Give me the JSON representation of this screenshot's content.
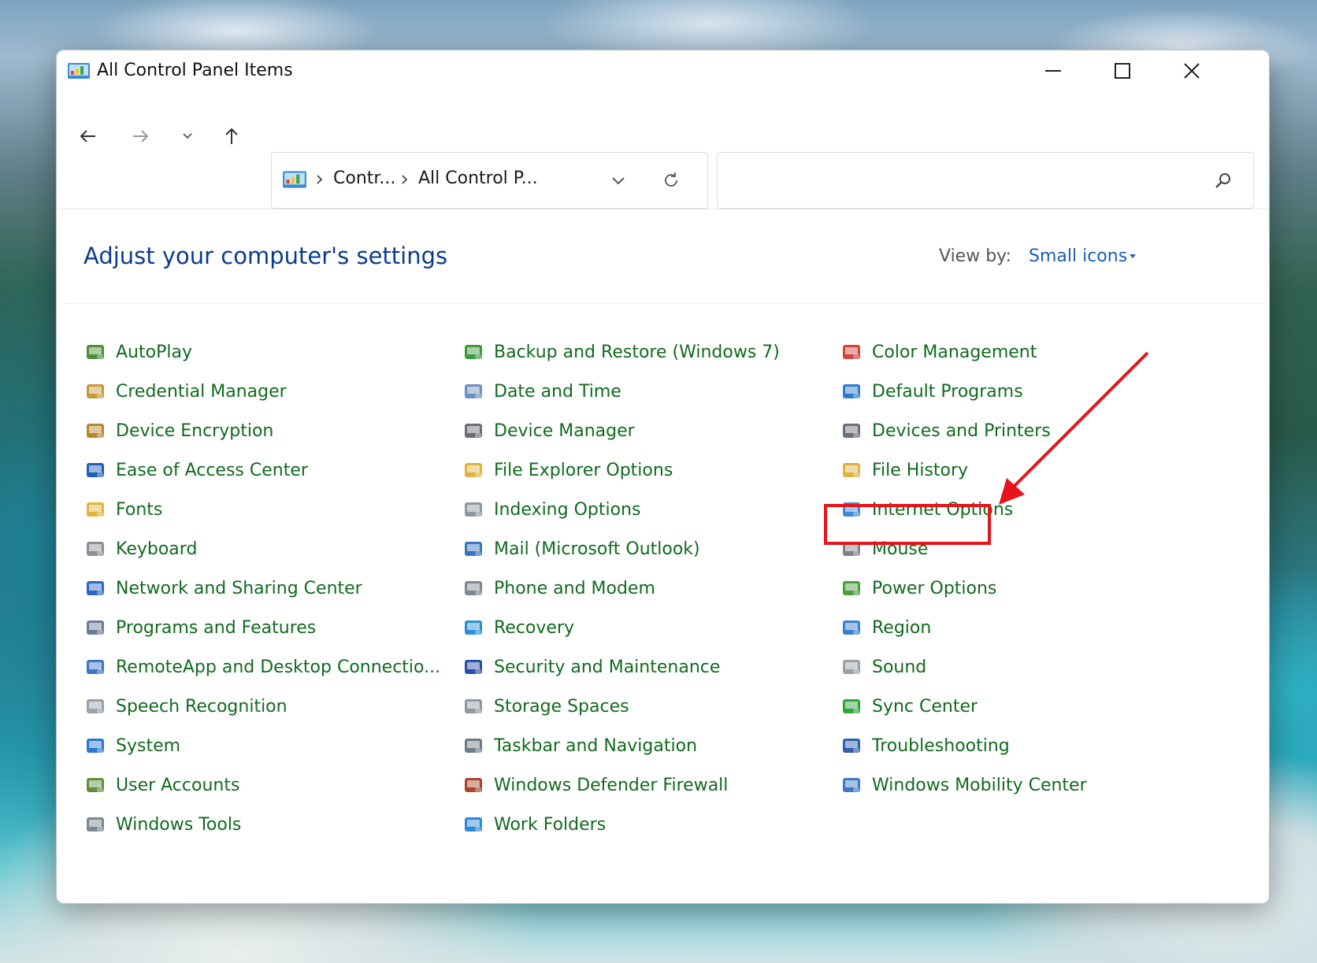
{
  "window": {
    "title": "All Control Panel Items"
  },
  "address_bar": {
    "crumbs": [
      "Contr...",
      "All Control P..."
    ]
  },
  "search": {
    "value": "",
    "placeholder": ""
  },
  "header": {
    "heading": "Adjust your computer's settings",
    "view_by_label": "View by:",
    "view_by_value": "Small icons"
  },
  "columns": [
    [
      {
        "label": "AutoPlay",
        "icon": "autoplay-icon",
        "color": "#4b8f3b"
      },
      {
        "label": "Credential Manager",
        "icon": "credential-manager-icon",
        "color": "#c79a3a"
      },
      {
        "label": "Device Encryption",
        "icon": "device-encryption-icon",
        "color": "#b8862c"
      },
      {
        "label": "Ease of Access Center",
        "icon": "ease-of-access-icon",
        "color": "#1f5fb8"
      },
      {
        "label": "Fonts",
        "icon": "fonts-icon",
        "color": "#e2b43a"
      },
      {
        "label": "Keyboard",
        "icon": "keyboard-icon",
        "color": "#8a8f96"
      },
      {
        "label": "Network and Sharing Center",
        "icon": "network-sharing-icon",
        "color": "#2d66c7"
      },
      {
        "label": "Programs and Features",
        "icon": "programs-features-icon",
        "color": "#6b7d92"
      },
      {
        "label": "RemoteApp and Desktop Connectio...",
        "icon": "remoteapp-icon",
        "color": "#3e73c8"
      },
      {
        "label": "Speech Recognition",
        "icon": "speech-recognition-icon",
        "color": "#9aa1a8"
      },
      {
        "label": "System",
        "icon": "system-icon",
        "color": "#2a78d0"
      },
      {
        "label": "User Accounts",
        "icon": "user-accounts-icon",
        "color": "#5f8f3f"
      },
      {
        "label": "Windows Tools",
        "icon": "windows-tools-icon",
        "color": "#7d8792"
      }
    ],
    [
      {
        "label": "Backup and Restore (Windows 7)",
        "icon": "backup-restore-icon",
        "color": "#3d9a3d"
      },
      {
        "label": "Date and Time",
        "icon": "date-time-icon",
        "color": "#6d90bf"
      },
      {
        "label": "Device Manager",
        "icon": "device-manager-icon",
        "color": "#6a6f76"
      },
      {
        "label": "File Explorer Options",
        "icon": "file-explorer-options-icon",
        "color": "#e0b340"
      },
      {
        "label": "Indexing Options",
        "icon": "indexing-options-icon",
        "color": "#8c97a3"
      },
      {
        "label": "Mail (Microsoft Outlook)",
        "icon": "mail-icon",
        "color": "#3a74c0"
      },
      {
        "label": "Phone and Modem",
        "icon": "phone-modem-icon",
        "color": "#7e868e"
      },
      {
        "label": "Recovery",
        "icon": "recovery-icon",
        "color": "#2c8fd6"
      },
      {
        "label": "Security and Maintenance",
        "icon": "security-maintenance-icon",
        "color": "#2a4fa8"
      },
      {
        "label": "Storage Spaces",
        "icon": "storage-spaces-icon",
        "color": "#8f979f"
      },
      {
        "label": "Taskbar and Navigation",
        "icon": "taskbar-navigation-icon",
        "color": "#6e7a88"
      },
      {
        "label": "Windows Defender Firewall",
        "icon": "firewall-icon",
        "color": "#a8462e"
      },
      {
        "label": "Work Folders",
        "icon": "work-folders-icon",
        "color": "#2f8ad6"
      }
    ],
    [
      {
        "label": "Color Management",
        "icon": "color-management-icon",
        "color": "#d0463a"
      },
      {
        "label": "Default Programs",
        "icon": "default-programs-icon",
        "color": "#2e7bd0"
      },
      {
        "label": "Devices and Printers",
        "icon": "devices-printers-icon",
        "color": "#6a7078"
      },
      {
        "label": "File History",
        "icon": "file-history-icon",
        "color": "#e0b340"
      },
      {
        "label": "Internet Options",
        "icon": "internet-options-icon",
        "color": "#3a8bd8"
      },
      {
        "label": "Mouse",
        "icon": "mouse-icon",
        "color": "#7b8189"
      },
      {
        "label": "Power Options",
        "icon": "power-options-icon",
        "color": "#4aa03f"
      },
      {
        "label": "Region",
        "icon": "region-icon",
        "color": "#3b7fd0"
      },
      {
        "label": "Sound",
        "icon": "sound-icon",
        "color": "#9aa0a6"
      },
      {
        "label": "Sync Center",
        "icon": "sync-center-icon",
        "color": "#2fa63c"
      },
      {
        "label": "Troubleshooting",
        "icon": "troubleshooting-icon",
        "color": "#2d5fae"
      },
      {
        "label": "Windows Mobility Center",
        "icon": "mobility-center-icon",
        "color": "#3f78c4"
      }
    ]
  ],
  "annotation": {
    "highlighted_item": "Mouse",
    "color": "#e8131b"
  }
}
